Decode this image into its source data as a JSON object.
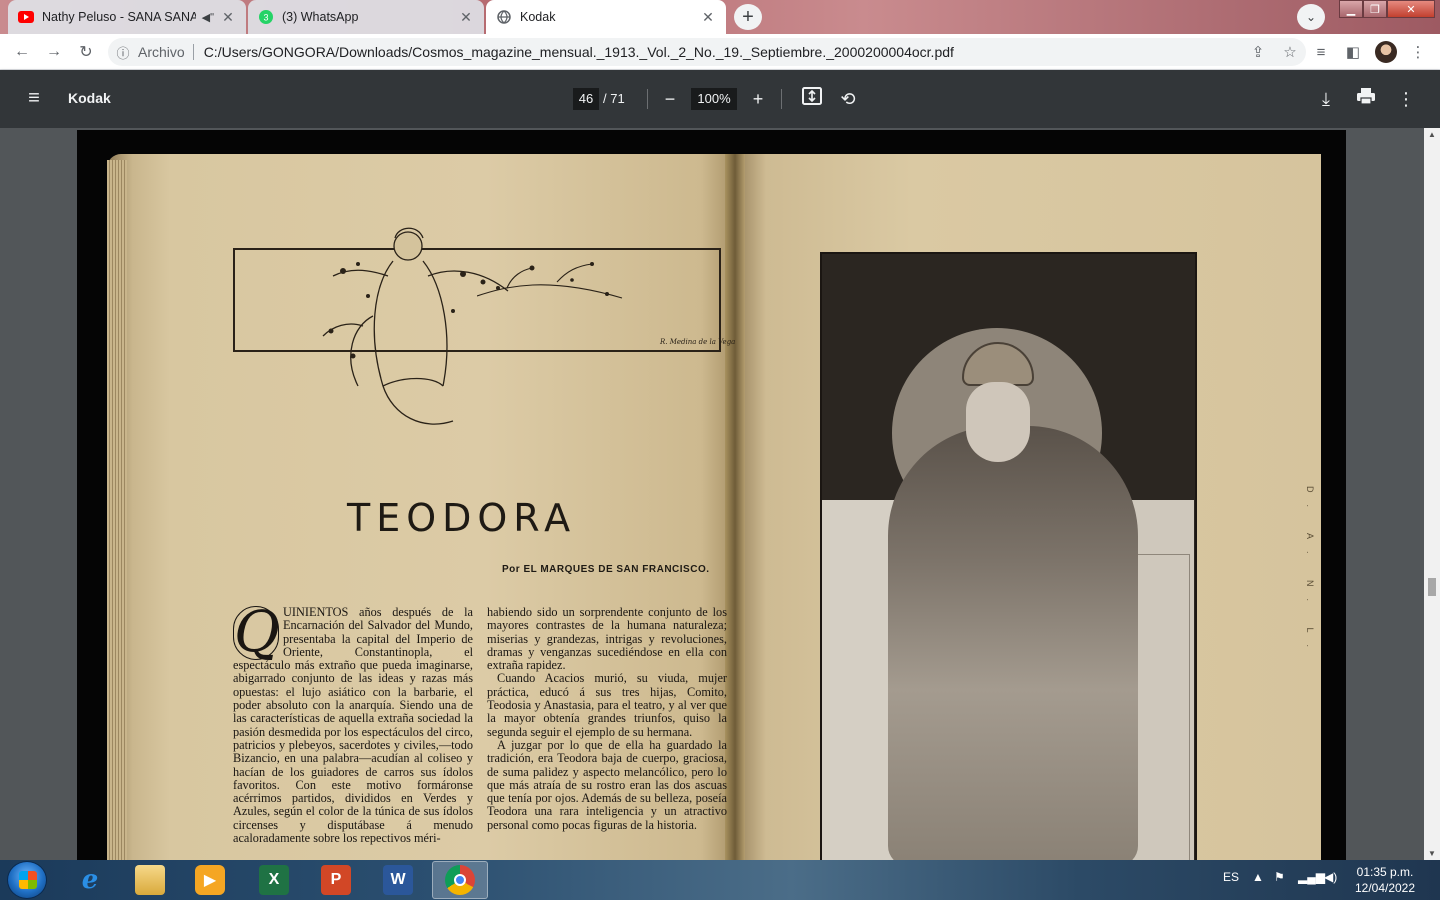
{
  "tabs": [
    {
      "title": "Nathy Peluso - SANA SANA",
      "icon": "youtube-icon",
      "audio": "speaker-icon"
    },
    {
      "title": "(3) WhatsApp",
      "icon": "whatsapp-icon"
    },
    {
      "title": "Kodak",
      "icon": "globe-icon",
      "active": true
    }
  ],
  "address": {
    "scheme": "Archivo",
    "url": "C:/Users/GONGORA/Downloads/Cosmos_magazine_mensual._1913._Vol._2_No._19._Septiembre._2000200004ocr.pdf"
  },
  "pdf": {
    "title": "Kodak",
    "page": "46",
    "total": "/ 71",
    "zoom": "100%"
  },
  "document": {
    "heading": "TEODORA",
    "byline": "Por EL MARQUES DE SAN FRANCISCO.",
    "signature": "R. Medina de la Vega",
    "dropcap": "Q",
    "col1": "UINIENTOS años después de la Encarnación del Salvador del Mundo, presentaba la capital del Imperio de Oriente, Constantinopla, el espectáculo más extraño que pueda imaginarse, abigarrado conjunto de las ideas y razas más opuestas: el lujo asiático con la barbarie, el poder absoluto con la anarquía. Siendo una de las características de aquella extraña sociedad la pasión desmedida por los espectáculos del circo, patricios y plebeyos, sacerdotes y civiles,—todo Bizancio, en una palabra—acudían al coliseo y hacían de los guiadores de carros sus ídolos favoritos. Con este motivo formáronse acérrimos partidos, divididos en Verdes y Azules, según el color de la túnica de sus ídolos circenses y disputábase á menudo acaloradamente sobre los repectivos méri-",
    "col2_p1": "habiendo sido un sorprendente conjunto de los mayores contrastes de la humana naturaleza; miserias y grandezas, intrigas y revoluciones, dramas y venganzas sucediéndose en ella con extraña rapidez.",
    "col2_p2": "Cuando Acacios murió, su viuda, mujer práctica, educó á sus tres hijas, Comito, Teodosia y Anastasia, para el teatro, y al ver que la mayor obtenía grandes triunfos, quiso la segunda seguir el ejemplo de su hermana.",
    "col2_p3": "A juzgar por lo que de ella ha guardado la tradición, era Teodora baja de cuerpo, graciosa, de suma palidez y aspecto melancólico, pero lo que más atraía de su rostro eran las dos ascuas que tenía por ojos. Además de su belleza, poseía Teodora una rara inteligencia y un atractivo personal como pocas figuras de la historia.",
    "side_label": "D. A. N. L."
  },
  "taskbar": {
    "lang": "ES",
    "time": "01:35 p.m.",
    "date": "12/04/2022",
    "apps": [
      "internet-explorer-icon",
      "file-explorer-icon",
      "media-player-icon",
      "excel-icon",
      "powerpoint-icon",
      "word-icon",
      "chrome-icon"
    ]
  }
}
